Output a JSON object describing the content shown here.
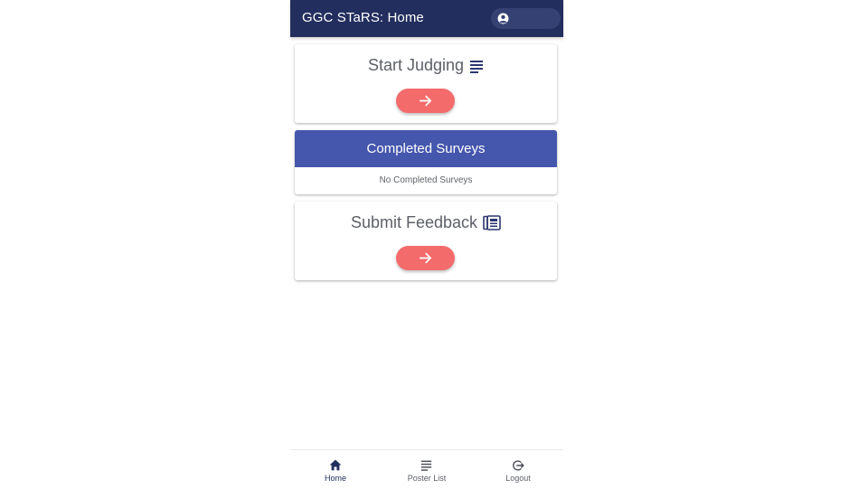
{
  "header": {
    "title": "GGC STaRS: Home",
    "account_icon": "account-circle-icon"
  },
  "cards": {
    "start_judging": {
      "title": "Start Judging",
      "icon": "list-icon",
      "button_icon": "arrow-right-icon"
    },
    "completed_surveys": {
      "title": "Completed Surveys",
      "empty_text": "No Completed Surveys"
    },
    "submit_feedback": {
      "title": "Submit Feedback",
      "icon": "newspaper-icon",
      "button_icon": "arrow-right-icon"
    }
  },
  "bottom_nav": {
    "items": [
      {
        "label": "Home",
        "icon": "home-icon",
        "active": true
      },
      {
        "label": "Poster List",
        "icon": "list-icon",
        "active": false
      },
      {
        "label": "Logout",
        "icon": "logout-icon",
        "active": false
      }
    ]
  },
  "colors": {
    "header_bg": "#222e5e",
    "completed_header_bg": "#4556ad",
    "action_button": "#f36b6b",
    "active_nav": "#222e5e"
  }
}
